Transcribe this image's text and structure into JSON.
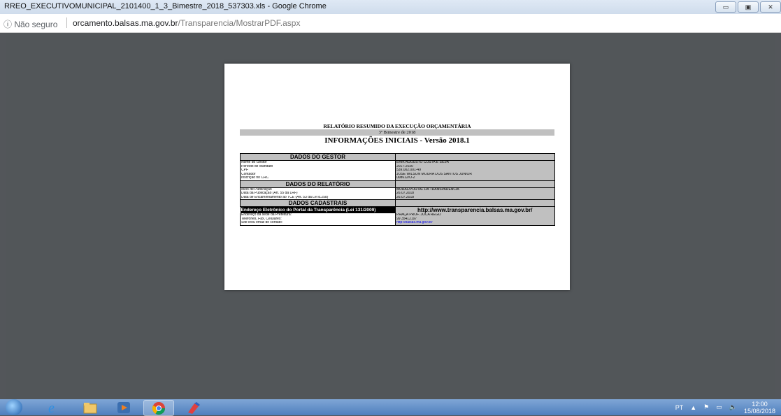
{
  "window": {
    "title": "RREO_EXECUTIVOMUNICIPAL_2101400_1_3_Bimestre_2018_537303.xls - Google Chrome",
    "buttons": [
      "▭",
      "▣",
      "✕"
    ]
  },
  "address_bar": {
    "security_label": "ⓘ Não seguro",
    "domain": "orcamento.balsas.ma.gov.br",
    "path": "/Transparencia/MostrarPDF.aspx"
  },
  "document": {
    "title": "RELATÓRIO RESUMIDO DA EXECUÇÃO ORÇAMENTÁRIA",
    "subtitle": "3º Bimestre de 2018",
    "heading": "INFORMAÇÕES INICIAIS - Versão 2018.1",
    "sections": {
      "gestor": {
        "header": "DADOS DO GESTOR",
        "rows": [
          {
            "label": "Nome do Gestor",
            "value": "ERIK AUGUSTO COSTA E SILVA"
          },
          {
            "label": "Período de Mandato",
            "value": "2017-2020"
          },
          {
            "label": "CPF",
            "value": "539.002.001-49"
          },
          {
            "label": "Contador",
            "value": "JOSÉ WILSON MOURA DOS SANTOS JUNIOR"
          },
          {
            "label": "Inscrição no CRC",
            "value": "008612/O-2"
          }
        ]
      },
      "relatorio": {
        "header": "DADOS DO RELATÓRIO",
        "rows": [
          {
            "label": "Meio de Publicação",
            "value": "MURAL/PORTAL DA TRANSPARÊNCIA"
          },
          {
            "label": "Data da Publicação (Art. 55 da LRF)",
            "value": "26.07.2018"
          },
          {
            "label": "Data de Encaminhamento ao TCE (Art. 53 da Lei 8.258)",
            "value": "26.07.2018"
          }
        ]
      },
      "cadastrais": {
        "header": "DADOS CADASTRAIS",
        "portal_label": "Endereço Eletrônico do Portal da Transparência (Lei 131/2009)",
        "portal_value": "http://www.transparencia.balsas.ma.gov.br/",
        "rows": [
          {
            "label": "Endereço da sede da Prefeitura:",
            "value": "PRAÇA PROF. JOCA REGO"
          },
          {
            "label": "Telefones, Fax, Celulares:",
            "value": "99 35412197"
          },
          {
            "label": "Site e/ou email de contato:",
            "value": "http://balsas.ma.gov.br/"
          }
        ]
      }
    }
  },
  "taskbar": {
    "lang": "PT",
    "time": "12:00",
    "date": "15/08/2018"
  }
}
